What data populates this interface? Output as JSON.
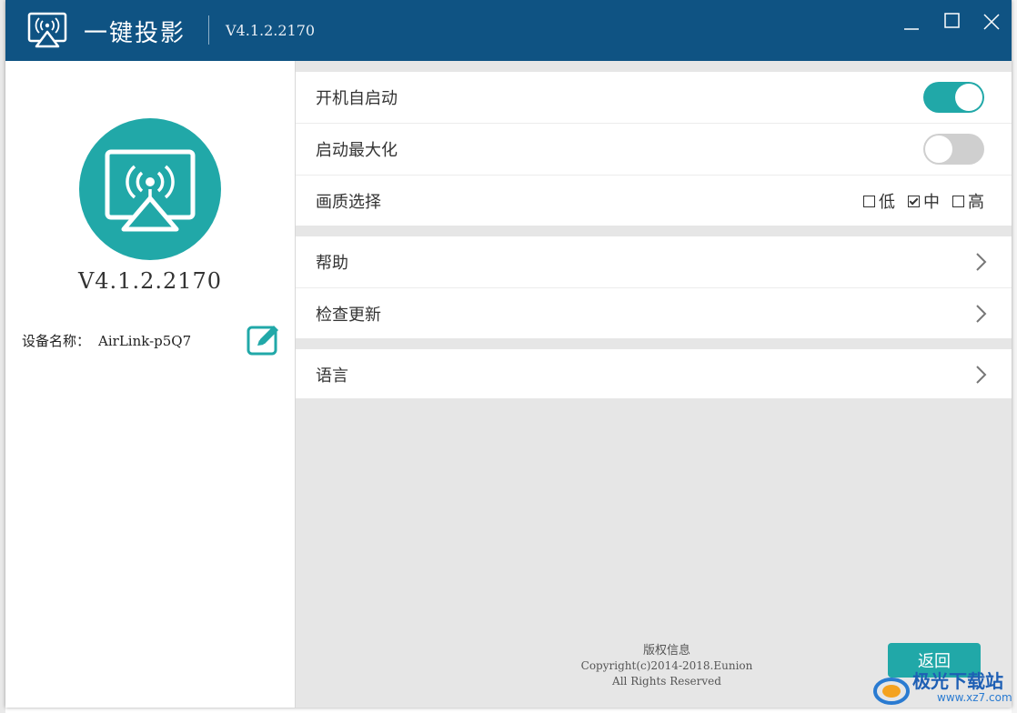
{
  "app": {
    "title": "一键投影",
    "version": "V4.1.2.2170"
  },
  "window_controls": [
    "minimize",
    "maximize",
    "close"
  ],
  "left_panel": {
    "version": "V4.1.2.2170",
    "device_label": "设备名称：",
    "device_name": "AirLink-p5Q7",
    "edit_icon": "edit-icon"
  },
  "settings": {
    "auto_start": {
      "label": "开机自启动",
      "enabled": true
    },
    "start_maximized": {
      "label": "启动最大化",
      "enabled": false
    },
    "quality": {
      "label": "画质选择",
      "options": [
        {
          "label": "低",
          "checked": false
        },
        {
          "label": "中",
          "checked": true
        },
        {
          "label": "高",
          "checked": false
        }
      ]
    },
    "help": {
      "label": "帮助"
    },
    "check_update": {
      "label": "检查更新"
    },
    "language": {
      "label": "语言"
    }
  },
  "footer": {
    "copyright_title": "版权信息",
    "copyright_line1": "Copyright(c)2014-2018.Eunion",
    "copyright_line2": "All Rights Reserved",
    "back_label": "返回"
  },
  "watermark": {
    "name": "极光下载站",
    "url": "www.xz7.com"
  },
  "colors": {
    "titlebar": "#0f5383",
    "accent": "#21a8a8",
    "toggle_off": "#cfcfcf",
    "background": "#e6e6e6"
  }
}
